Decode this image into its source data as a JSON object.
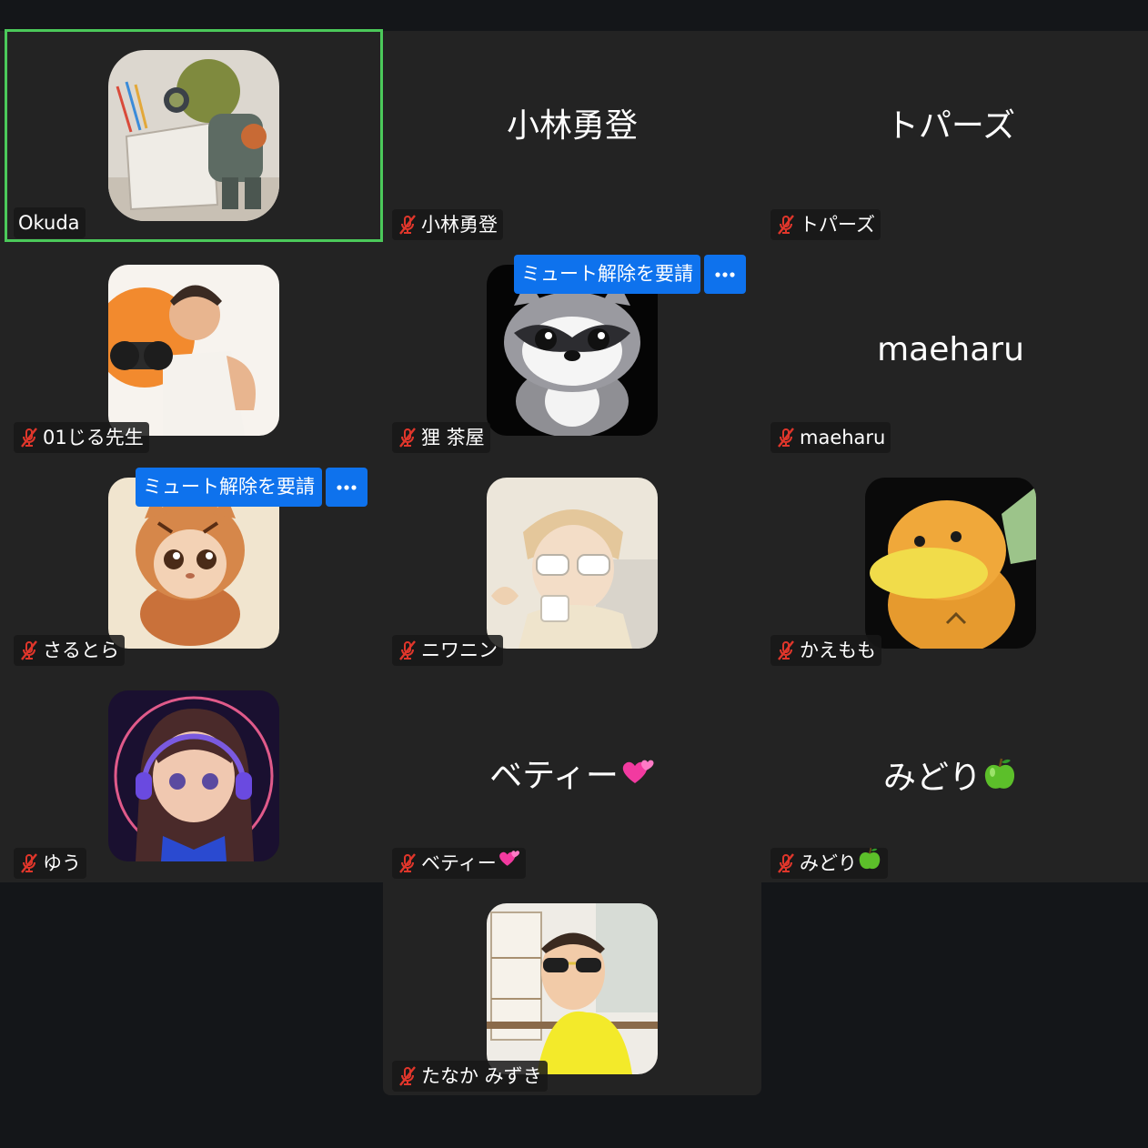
{
  "participants": [
    {
      "name": "Okuda",
      "avatar": "robot",
      "active": true,
      "muted": false
    },
    {
      "name": "小林勇登",
      "display_name": "小林勇登",
      "muted": true
    },
    {
      "name": "トパーズ",
      "display_name": "トパーズ",
      "muted": true
    },
    {
      "name": "01じる先生",
      "avatar": "athlete",
      "muted": true
    },
    {
      "name": "狸 茶屋",
      "avatar": "raccoon",
      "muted": true
    },
    {
      "name": "maeharu",
      "display_name": "maeharu",
      "muted": true
    },
    {
      "name": "さるとら",
      "avatar": "tiger-cub",
      "muted": true
    },
    {
      "name": "ニワニン",
      "avatar": "glasses-person",
      "muted": true
    },
    {
      "name": "かえもも",
      "avatar": "platypus",
      "muted": true
    },
    {
      "name": "ゆう",
      "avatar": "headphone-girl",
      "muted": true
    },
    {
      "name": "ベティー",
      "display_name": "ベティー",
      "name_emoji": "two-hearts-icon",
      "muted": true
    },
    {
      "name": "みどり",
      "display_name": "みどり",
      "name_emoji": "green-apple-icon",
      "muted": true
    },
    {
      "name": "たなか みずき",
      "avatar": "sunglasses-man",
      "muted": true
    }
  ],
  "overlays": {
    "request_unmute_label": "ミュート解除を要請",
    "more_icon": "ellipsis-icon"
  },
  "colors": {
    "active_speaker_border": "#4bc95a",
    "button_blue": "#0e72ed",
    "mute_red": "#e0362b",
    "tile_bg": "#232323",
    "page_bg": "#141619"
  }
}
